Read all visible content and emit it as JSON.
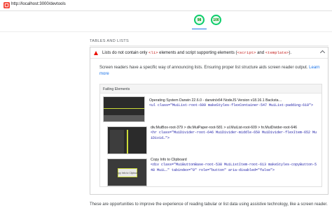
{
  "browser": {
    "url": "http://localhost:3000/devtools"
  },
  "scores": [
    {
      "value": "98",
      "color": "#0cce6b"
    },
    {
      "value": "100",
      "color": "#0cce6b"
    }
  ],
  "section": {
    "title": "TABLES AND LISTS"
  },
  "audit": {
    "status": "fail",
    "title_pre": "Lists do not contain only ",
    "title_code1": "<li>",
    "title_mid": " elements and script supporting elements (",
    "title_code2": "<script>",
    "title_and": " and ",
    "title_code3": "<template>",
    "title_post": ").",
    "description": "Screen readers have a specific way of announcing lists. Ensuring proper list structure aids screen reader output.",
    "learn_more": "Learn more",
    "failing_header": "Failing Elements",
    "items": [
      {
        "label": "Operating System Darwin 22.6.0 - darwin/x64 NodeJS Version v18.16.1 Backsta…",
        "snippet": "<ul class=\"MuiList-root-609 makeStyles-flexContainer-547 MuiList-padding-610\">"
      },
      {
        "label": "div.MuiBox-root-379 > div.MuiPaper-root-581 > ul.MuiList-root-609 > hr.MuiDivider-root-646",
        "snippet": "<hr class=\"MuiDivider-root-646 MuiDivider-middle-650 MuiDivider-flexItem-652 MuiDivid…\">"
      },
      {
        "label": "Copy Info to Clipboard",
        "snippet": "<div class=\"MuiButtonBase-root-538 MuiListItem-root-613 makeStyles-copyButton-548 MuiL…\" tabindex=\"0\" role=\"button\" aria-disabled=\"false\">",
        "thumb_text": "Copy Info to Clipboard"
      }
    ]
  },
  "footer": {
    "text": "These are opportunities to improve the experience of reading tabular or list data using assistive technology, like a screen reader."
  },
  "colors": {
    "accent": "#1a73e8",
    "fail": "#eb0f00",
    "pass": "#0cce6b"
  }
}
